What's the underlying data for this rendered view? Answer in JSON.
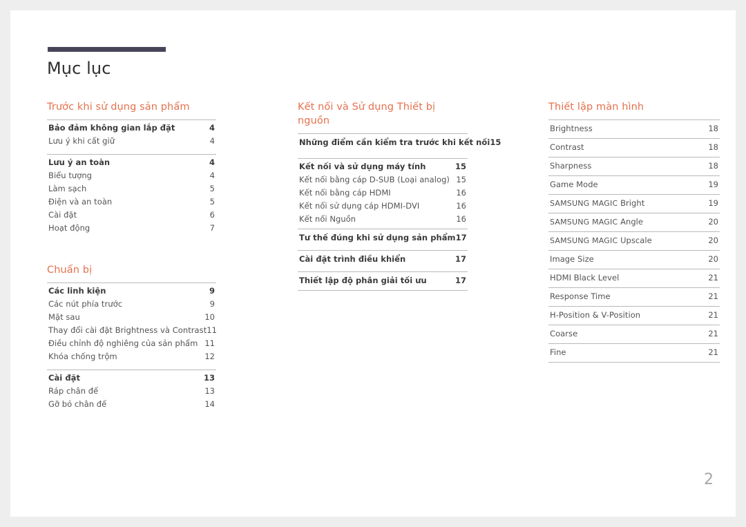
{
  "document": {
    "title": "Mục lục",
    "page_number": "2",
    "accent_color": "#e4714d",
    "rule_color": "#474457",
    "text_color": "#535353"
  },
  "columns": [
    {
      "sections": [
        {
          "heading": "Trước khi sử dụng sản phẩm",
          "groups": [
            {
              "entries": [
                {
                  "label": "Bảo đảm không gian lắp đặt",
                  "page": "4",
                  "bold": true
                },
                {
                  "label": "Lưu ý khi cất giữ",
                  "page": "4",
                  "bold": false
                }
              ]
            },
            {
              "entries": [
                {
                  "label": "Lưu ý an toàn",
                  "page": "4",
                  "bold": true
                },
                {
                  "label": "Biểu tượng",
                  "page": "4",
                  "bold": false
                },
                {
                  "label": "Làm sạch",
                  "page": "5",
                  "bold": false
                },
                {
                  "label": "Điện và an toàn",
                  "page": "5",
                  "bold": false
                },
                {
                  "label": "Cài đặt",
                  "page": "6",
                  "bold": false
                },
                {
                  "label": "Hoạt động",
                  "page": "7",
                  "bold": false
                }
              ]
            }
          ]
        },
        {
          "heading": "Chuẩn bị",
          "groups": [
            {
              "entries": [
                {
                  "label": "Các linh kiện",
                  "page": "9",
                  "bold": true
                },
                {
                  "label": "Các nút phía trước",
                  "page": "9",
                  "bold": false
                },
                {
                  "label": "Mặt sau",
                  "page": "10",
                  "bold": false
                },
                {
                  "label": "Thay đổi cài đặt Brightness và Contrast",
                  "page": "11",
                  "bold": false
                },
                {
                  "label": "Điều chỉnh độ nghiêng của sản phẩm",
                  "page": "11",
                  "bold": false
                },
                {
                  "label": "Khóa chống trộm",
                  "page": "12",
                  "bold": false
                }
              ]
            },
            {
              "entries": [
                {
                  "label": "Cài đặt",
                  "page": "13",
                  "bold": true
                },
                {
                  "label": "Ráp chân đế",
                  "page": "13",
                  "bold": false
                },
                {
                  "label": "Gỡ bỏ chân đế",
                  "page": "14",
                  "bold": false
                }
              ]
            }
          ]
        }
      ]
    },
    {
      "sections": [
        {
          "heading": "Kết nối và Sử dụng Thiết bị nguồn",
          "groups": [
            {
              "entries": [
                {
                  "label": "Những điểm cần kiểm tra trước khi kết nối",
                  "page": "15",
                  "bold": true
                }
              ]
            },
            {
              "entries": [
                {
                  "label": "Kết nối và sử dụng máy tính",
                  "page": "15",
                  "bold": true
                },
                {
                  "label": "Kết nối bằng cáp D-SUB (Loại analog)",
                  "page": "15",
                  "bold": false
                },
                {
                  "label": "Kết nối bằng cáp HDMI",
                  "page": "16",
                  "bold": false
                },
                {
                  "label": "Kết nối sử dụng cáp HDMI-DVI",
                  "page": "16",
                  "bold": false
                },
                {
                  "label": "Kết nối Nguồn",
                  "page": "16",
                  "bold": false
                }
              ]
            },
            {
              "entries": [
                {
                  "label": "Tư thế đúng khi sử dụng sản phẩm",
                  "page": "17",
                  "bold": true
                }
              ]
            },
            {
              "entries": [
                {
                  "label": "Cài đặt trình điều khiển",
                  "page": "17",
                  "bold": true
                }
              ]
            },
            {
              "entries": [
                {
                  "label": "Thiết lập độ phân giải tối ưu",
                  "page": "17",
                  "bold": true
                }
              ]
            }
          ]
        }
      ]
    },
    {
      "sections": [
        {
          "heading": "Thiết lập màn hình",
          "groups": [
            {
              "entries": [
                {
                  "label": "Brightness",
                  "page": "18",
                  "bold": false
                }
              ]
            },
            {
              "entries": [
                {
                  "label": "Contrast",
                  "page": "18",
                  "bold": false
                }
              ]
            },
            {
              "entries": [
                {
                  "label": "Sharpness",
                  "page": "18",
                  "bold": false
                }
              ]
            },
            {
              "entries": [
                {
                  "label": "Game Mode",
                  "page": "19",
                  "bold": false
                }
              ]
            },
            {
              "entries": [
                {
                  "label": "SAMSUNG MAGIC Bright",
                  "page": "19",
                  "bold": false
                }
              ]
            },
            {
              "entries": [
                {
                  "label": "SAMSUNG MAGIC Angle",
                  "page": "20",
                  "bold": false
                }
              ]
            },
            {
              "entries": [
                {
                  "label": "SAMSUNG MAGIC Upscale",
                  "page": "20",
                  "bold": false
                }
              ]
            },
            {
              "entries": [
                {
                  "label": "Image Size",
                  "page": "20",
                  "bold": false
                }
              ]
            },
            {
              "entries": [
                {
                  "label": "HDMI Black Level",
                  "page": "21",
                  "bold": false
                }
              ]
            },
            {
              "entries": [
                {
                  "label": "Response Time",
                  "page": "21",
                  "bold": false
                }
              ]
            },
            {
              "entries": [
                {
                  "label": "H-Position & V-Position",
                  "page": "21",
                  "bold": false
                }
              ]
            },
            {
              "entries": [
                {
                  "label": "Coarse",
                  "page": "21",
                  "bold": false
                }
              ]
            },
            {
              "entries": [
                {
                  "label": "Fine",
                  "page": "21",
                  "bold": false
                }
              ]
            }
          ]
        }
      ]
    }
  ]
}
